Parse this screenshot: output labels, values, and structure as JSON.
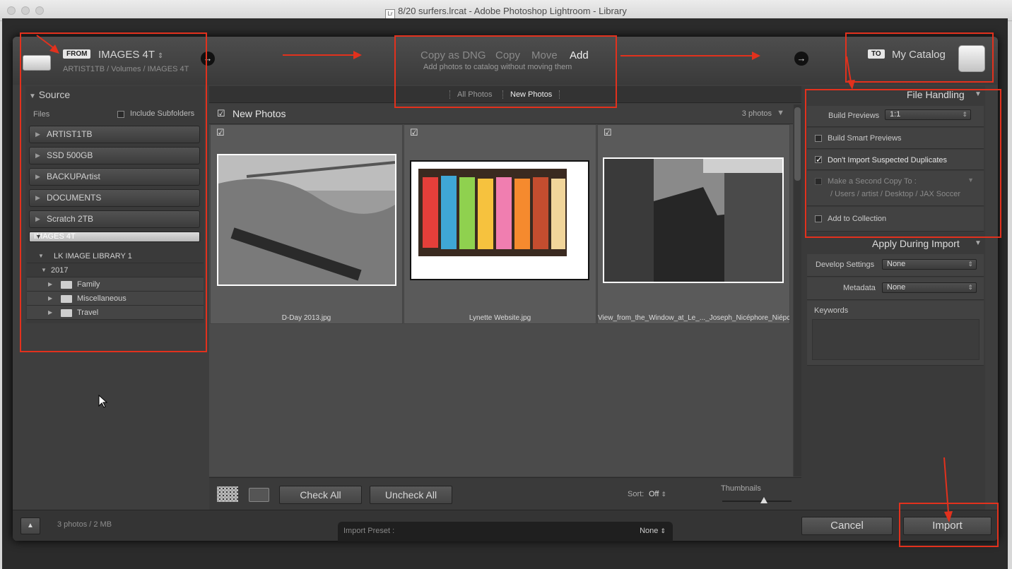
{
  "window": {
    "title": "8/20 surfers.lrcat - Adobe Photoshop Lightroom - Library",
    "app_badge": "Lr"
  },
  "source_bar": {
    "from_label": "FROM",
    "source_name": "IMAGES 4T",
    "source_path": "ARTIST1TB / Volumes / IMAGES 4T"
  },
  "modes": {
    "items": [
      "Copy as DNG",
      "Copy",
      "Move",
      "Add"
    ],
    "selected": "Add",
    "description": "Add photos to catalog without moving them"
  },
  "dest_bar": {
    "to_label": "TO",
    "dest_name": "My Catalog"
  },
  "view_tabs": {
    "all": "All Photos",
    "new": "New Photos"
  },
  "source_panel": {
    "title": "Source",
    "files_label": "Files",
    "include_subfolders": "Include Subfolders",
    "volumes": [
      "ARTIST1TB",
      "SSD 500GB",
      "BACKUPArtist",
      "DOCUMENTS",
      "Scratch 2TB",
      "IMAGES 4T"
    ],
    "tree": {
      "library": "LK IMAGE LIBRARY 1",
      "year": "2017",
      "folders": [
        "Family",
        "Miscellaneous",
        "Travel"
      ]
    }
  },
  "grid": {
    "header": "New Photos",
    "count": "3 photos",
    "photos": [
      {
        "name": "D-Day 2013.jpg"
      },
      {
        "name": "Lynette Website.jpg"
      },
      {
        "name": "View_from_the_Window_at_Le_..._Joseph_Nicéphore_Niépce.jpg"
      }
    ]
  },
  "toolbar": {
    "check_all": "Check All",
    "uncheck_all": "Uncheck All",
    "sort_label": "Sort:",
    "sort_value": "Off",
    "thumbnails_label": "Thumbnails",
    "thumb_size": 0.6
  },
  "file_handling": {
    "title": "File Handling",
    "build_previews_label": "Build Previews",
    "build_previews_value": "1:1",
    "smart_previews": "Build Smart Previews",
    "dont_import_dupes": "Don't Import Suspected Duplicates",
    "second_copy_label": "Make a Second Copy To :",
    "second_copy_path": "/ Users / artist / Desktop / JAX Soccer",
    "add_to_collection": "Add to Collection"
  },
  "apply_during_import": {
    "title": "Apply During Import",
    "develop_label": "Develop Settings",
    "develop_value": "None",
    "metadata_label": "Metadata",
    "metadata_value": "None",
    "keywords_label": "Keywords"
  },
  "bottom": {
    "stats": "3 photos / 2 MB",
    "preset_label": "Import Preset :",
    "preset_value": "None",
    "cancel": "Cancel",
    "import": "Import"
  },
  "annotation_color": "#e2311d"
}
